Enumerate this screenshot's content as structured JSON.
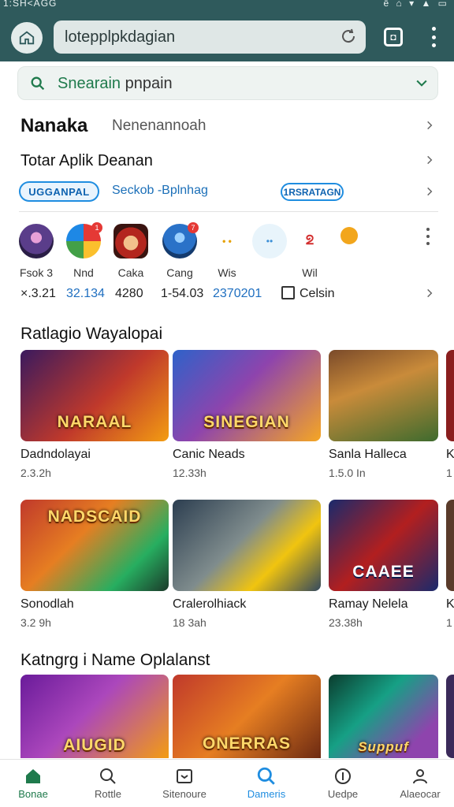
{
  "status_bar": {
    "left": "1:SH<AGG",
    "right": "ê ⌂ ▾ ▲ ▭"
  },
  "browser": {
    "url": "lotepplpkdagian"
  },
  "search": {
    "prefix": "Snearain",
    "query": " pnpain"
  },
  "header": {
    "title": "Nanaka",
    "subtitle": "Nenenannoah",
    "row2": "Totar Aplik  Deanan"
  },
  "chips": {
    "chip1": "UGGANPAL",
    "text": "Seckob -Bplnhag",
    "chip2": "1RSRATAGN"
  },
  "apps": [
    {
      "label": "Fsok 3",
      "stat": "×.3.21",
      "badge": ""
    },
    {
      "label": "Nnd",
      "stat": "32.134",
      "badge": "1"
    },
    {
      "label": "Caka",
      "stat": "4280",
      "badge": ""
    },
    {
      "label": "Cang",
      "stat": "1-54.03",
      "badge": "7"
    },
    {
      "label": "Wis",
      "stat": "2370201",
      "badge": ""
    },
    {
      "label": "",
      "stat": "",
      "badge": ""
    },
    {
      "label": "Wil",
      "stat": "",
      "badge": ""
    },
    {
      "label": "",
      "stat": "",
      "badge": ""
    }
  ],
  "checkbox_label": "Celsin",
  "sections": [
    {
      "title": "Ratlagio Wayalopai"
    },
    {
      "title": "Katngrg i Name Oplalanst"
    }
  ],
  "games_row1": [
    {
      "name": "Dadndolayai",
      "size": "2.3.2h",
      "art": "NARAAL"
    },
    {
      "name": "Canic Neads",
      "size": "12.33h",
      "art": "SINEGIAN"
    },
    {
      "name": "Sanla Halleca",
      "size": "1.5.0 In",
      "art": ""
    },
    {
      "name": "K",
      "size": "1",
      "art": ""
    }
  ],
  "games_row2": [
    {
      "name": "Sonodlah",
      "size": "3.2 9h",
      "art": "NADSCAID"
    },
    {
      "name": "Cralerolhiack",
      "size": "18 3ah",
      "art": ""
    },
    {
      "name": "Ramay Nelela",
      "size": "23.38h",
      "art": "CAAEE"
    },
    {
      "name": "K",
      "size": "1",
      "art": ""
    }
  ],
  "games_row3": [
    {
      "art": "AIUGID"
    },
    {
      "art": "ONERRAS"
    },
    {
      "art": "Suppuf"
    }
  ],
  "bottom_nav": [
    {
      "label": "Bonae"
    },
    {
      "label": "Rottle"
    },
    {
      "label": "Sitenoure"
    },
    {
      "label": "Dameris"
    },
    {
      "label": "Uedpe"
    },
    {
      "label": "Alaeocar"
    }
  ]
}
